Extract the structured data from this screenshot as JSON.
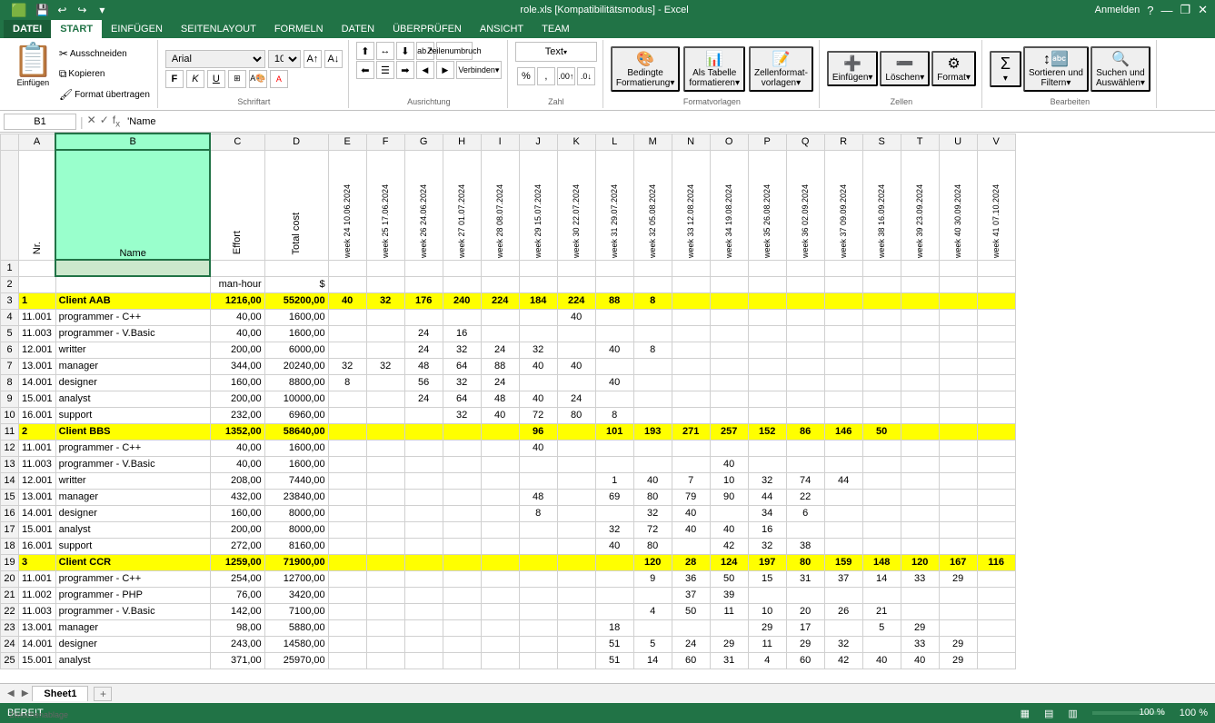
{
  "window": {
    "title": "role.xls [Kompatibilitätsmodus] - Excel",
    "help_icon": "?",
    "minimize": "—",
    "restore": "❐",
    "close": "✕"
  },
  "quick_access": {
    "save": "💾",
    "undo": "↩",
    "redo": "↪",
    "dropdown": "▾"
  },
  "ribbon": {
    "tabs": [
      {
        "id": "datei",
        "label": "DATEI"
      },
      {
        "id": "start",
        "label": "START",
        "active": true
      },
      {
        "id": "einfuegen",
        "label": "EINFÜGEN"
      },
      {
        "id": "seitenlayout",
        "label": "SEITENLAYOUT"
      },
      {
        "id": "formeln",
        "label": "FORMELN"
      },
      {
        "id": "daten",
        "label": "DATEN"
      },
      {
        "id": "ueberpruefen",
        "label": "ÜBERPRÜFEN"
      },
      {
        "id": "ansicht",
        "label": "ANSICHT"
      },
      {
        "id": "team",
        "label": "TEAM"
      }
    ],
    "groups": {
      "zwischenablage": "Zwischenablage",
      "schriftart": "Schriftart",
      "ausrichtung": "Ausrichtung",
      "zahl": "Zahl",
      "formatvorlagen": "Formatvorlagen",
      "zellen": "Zellen",
      "bearbeiten": "Bearbeiten"
    },
    "font_name": "Arial",
    "font_size": "10",
    "number_format": "Text",
    "anmelden": "Anmelden"
  },
  "formula_bar": {
    "cell_ref": "B1",
    "formula": "'Name"
  },
  "columns": {
    "row_num": "",
    "A": "A",
    "B": "B",
    "C": "C",
    "D": "D",
    "E": "E",
    "F": "F",
    "G": "G",
    "H": "H",
    "I": "I",
    "J": "J",
    "K": "K",
    "L": "L",
    "M": "M",
    "N": "N",
    "O": "O",
    "P": "P",
    "Q": "Q",
    "R": "R",
    "S": "S",
    "T": "T",
    "U": "U",
    "V": "V"
  },
  "week_headers": [
    "week 24 10.06.2024",
    "week 25 17.06.2024",
    "week 26 24.06.2024",
    "week 27 01.07.2024",
    "week 28 08.07.2024",
    "week 29 15.07.2024",
    "week 30 22.07.2024",
    "week 31 29.07.2024",
    "week 32 05.08.2024",
    "week 33 12.08.2024",
    "week 34 19.08.2024",
    "week 35 26.08.2024",
    "week 36 02.09.2024",
    "week 37 09.09.2024",
    "week 38 16.09.2024",
    "week 39 23.09.2024",
    "week 40 30.09.2024",
    "week 41 07.10.2024"
  ],
  "header_row": {
    "nr": "Nr.",
    "name": "Name",
    "effort": "Effort",
    "total_cost": "Total cost",
    "unit_row": {
      "effort": "man-hour",
      "total_cost": "$"
    }
  },
  "rows": [
    {
      "row": 1,
      "nr": "",
      "name": "",
      "effort": "",
      "total_cost": "",
      "yellow": false,
      "weeks": [
        "",
        "",
        "",
        "",
        "",
        "",
        "",
        "",
        "",
        "",
        "",
        "",
        "",
        "",
        "",
        "",
        "",
        ""
      ]
    },
    {
      "row": 2,
      "nr": "",
      "name": "",
      "effort": "man-hour",
      "total_cost": "$",
      "yellow": false,
      "weeks": [
        "",
        "",
        "",
        "",
        "",
        "",
        "",
        "",
        "",
        "",
        "",
        "",
        "",
        "",
        "",
        "",
        "",
        ""
      ]
    },
    {
      "row": 3,
      "nr": "1",
      "name": "Client AAB",
      "effort": "1216,00",
      "total_cost": "55200,00",
      "yellow": true,
      "weeks": [
        "40",
        "32",
        "176",
        "240",
        "224",
        "184",
        "224",
        "88",
        "8",
        "",
        "",
        "",
        "",
        "",
        "",
        "",
        "",
        ""
      ]
    },
    {
      "row": 4,
      "nr": "11.001",
      "name": "programmer - C++",
      "effort": "40,00",
      "total_cost": "1600,00",
      "yellow": false,
      "weeks": [
        "",
        "",
        "",
        "",
        "",
        "",
        "40",
        "",
        "",
        "",
        "",
        "",
        "",
        "",
        "",
        "",
        "",
        ""
      ]
    },
    {
      "row": 5,
      "nr": "11.003",
      "name": "programmer - V.Basic",
      "effort": "40,00",
      "total_cost": "1600,00",
      "yellow": false,
      "weeks": [
        "",
        "",
        "24",
        "16",
        "",
        "",
        "",
        "",
        "",
        "",
        "",
        "",
        "",
        "",
        "",
        "",
        "",
        ""
      ]
    },
    {
      "row": 6,
      "nr": "12.001",
      "name": "writter",
      "effort": "200,00",
      "total_cost": "6000,00",
      "yellow": false,
      "weeks": [
        "",
        "",
        "24",
        "32",
        "24",
        "32",
        "",
        "40",
        "8",
        "",
        "",
        "",
        "",
        "",
        "",
        "",
        "",
        ""
      ]
    },
    {
      "row": 7,
      "nr": "13.001",
      "name": "manager",
      "effort": "344,00",
      "total_cost": "20240,00",
      "yellow": false,
      "weeks": [
        "32",
        "32",
        "48",
        "64",
        "88",
        "40",
        "40",
        "",
        "",
        "",
        "",
        "",
        "",
        "",
        "",
        "",
        "",
        ""
      ]
    },
    {
      "row": 8,
      "nr": "14.001",
      "name": "designer",
      "effort": "160,00",
      "total_cost": "8800,00",
      "yellow": false,
      "weeks": [
        "8",
        "",
        "56",
        "32",
        "24",
        "",
        "",
        "40",
        "",
        "",
        "",
        "",
        "",
        "",
        "",
        "",
        "",
        ""
      ]
    },
    {
      "row": 9,
      "nr": "15.001",
      "name": "analyst",
      "effort": "200,00",
      "total_cost": "10000,00",
      "yellow": false,
      "weeks": [
        "",
        "",
        "24",
        "64",
        "48",
        "40",
        "24",
        "",
        "",
        "",
        "",
        "",
        "",
        "",
        "",
        "",
        "",
        ""
      ]
    },
    {
      "row": 10,
      "nr": "16.001",
      "name": "support",
      "effort": "232,00",
      "total_cost": "6960,00",
      "yellow": false,
      "weeks": [
        "",
        "",
        "",
        "32",
        "40",
        "72",
        "80",
        "8",
        "",
        "",
        "",
        "",
        "",
        "",
        "",
        "",
        "",
        ""
      ]
    },
    {
      "row": 11,
      "nr": "2",
      "name": "Client BBS",
      "effort": "1352,00",
      "total_cost": "58640,00",
      "yellow": true,
      "weeks": [
        "",
        "",
        "",
        "",
        "",
        "96",
        "",
        "101",
        "193",
        "271",
        "257",
        "152",
        "86",
        "146",
        "50",
        "",
        "",
        ""
      ]
    },
    {
      "row": 12,
      "nr": "11.001",
      "name": "programmer - C++",
      "effort": "40,00",
      "total_cost": "1600,00",
      "yellow": false,
      "weeks": [
        "",
        "",
        "",
        "",
        "",
        "40",
        "",
        "",
        "",
        "",
        "",
        "",
        "",
        "",
        "",
        "",
        "",
        ""
      ]
    },
    {
      "row": 13,
      "nr": "11.003",
      "name": "programmer - V.Basic",
      "effort": "40,00",
      "total_cost": "1600,00",
      "yellow": false,
      "weeks": [
        "",
        "",
        "",
        "",
        "",
        "",
        "",
        "",
        "",
        "",
        "40",
        "",
        "",
        "",
        "",
        "",
        "",
        ""
      ]
    },
    {
      "row": 14,
      "nr": "12.001",
      "name": "writter",
      "effort": "208,00",
      "total_cost": "7440,00",
      "yellow": false,
      "weeks": [
        "",
        "",
        "",
        "",
        "",
        "",
        "",
        "1",
        "40",
        "7",
        "10",
        "32",
        "74",
        "44",
        "",
        "",
        "",
        ""
      ]
    },
    {
      "row": 15,
      "nr": "13.001",
      "name": "manager",
      "effort": "432,00",
      "total_cost": "23840,00",
      "yellow": false,
      "weeks": [
        "",
        "",
        "",
        "",
        "",
        "48",
        "",
        "69",
        "80",
        "79",
        "90",
        "44",
        "22",
        "",
        "",
        "",
        "",
        ""
      ]
    },
    {
      "row": 16,
      "nr": "14.001",
      "name": "designer",
      "effort": "160,00",
      "total_cost": "8000,00",
      "yellow": false,
      "weeks": [
        "",
        "",
        "",
        "",
        "",
        "8",
        "",
        "",
        "32",
        "40",
        "",
        "34",
        "6",
        "",
        "",
        "",
        "",
        ""
      ]
    },
    {
      "row": 17,
      "nr": "15.001",
      "name": "analyst",
      "effort": "200,00",
      "total_cost": "8000,00",
      "yellow": false,
      "weeks": [
        "",
        "",
        "",
        "",
        "",
        "",
        "",
        "32",
        "72",
        "40",
        "40",
        "16",
        "",
        "",
        "",
        "",
        "",
        ""
      ]
    },
    {
      "row": 18,
      "nr": "16.001",
      "name": "support",
      "effort": "272,00",
      "total_cost": "8160,00",
      "yellow": false,
      "weeks": [
        "",
        "",
        "",
        "",
        "",
        "",
        "",
        "40",
        "80",
        "",
        "42",
        "32",
        "38",
        "",
        "",
        "",
        "",
        ""
      ]
    },
    {
      "row": 19,
      "nr": "3",
      "name": "Client CCR",
      "effort": "1259,00",
      "total_cost": "71900,00",
      "yellow": true,
      "weeks": [
        "",
        "",
        "",
        "",
        "",
        "",
        "",
        "",
        "120",
        "28",
        "124",
        "197",
        "80",
        "159",
        "148",
        "120",
        "167",
        "116"
      ]
    },
    {
      "row": 20,
      "nr": "11.001",
      "name": "programmer - C++",
      "effort": "254,00",
      "total_cost": "12700,00",
      "yellow": false,
      "weeks": [
        "",
        "",
        "",
        "",
        "",
        "",
        "",
        "",
        "9",
        "36",
        "50",
        "15",
        "31",
        "37",
        "14",
        "33",
        "29",
        ""
      ]
    },
    {
      "row": 21,
      "nr": "11.002",
      "name": "programmer - PHP",
      "effort": "76,00",
      "total_cost": "3420,00",
      "yellow": false,
      "weeks": [
        "",
        "",
        "",
        "",
        "",
        "",
        "",
        "",
        "",
        "37",
        "39",
        "",
        "",
        "",
        "",
        "",
        "",
        ""
      ]
    },
    {
      "row": 22,
      "nr": "11.003",
      "name": "programmer - V.Basic",
      "effort": "142,00",
      "total_cost": "7100,00",
      "yellow": false,
      "weeks": [
        "",
        "",
        "",
        "",
        "",
        "",
        "",
        "",
        "4",
        "50",
        "11",
        "10",
        "20",
        "26",
        "21",
        "",
        "",
        ""
      ]
    },
    {
      "row": 23,
      "nr": "13.001",
      "name": "manager",
      "effort": "98,00",
      "total_cost": "5880,00",
      "yellow": false,
      "weeks": [
        "",
        "",
        "",
        "",
        "",
        "",
        "",
        "18",
        "",
        "",
        "",
        "29",
        "17",
        "",
        "5",
        "29",
        "",
        ""
      ]
    },
    {
      "row": 24,
      "nr": "14.001",
      "name": "designer",
      "effort": "243,00",
      "total_cost": "14580,00",
      "yellow": false,
      "weeks": [
        "",
        "",
        "",
        "",
        "",
        "",
        "",
        "51",
        "5",
        "24",
        "29",
        "11",
        "29",
        "32",
        "",
        "33",
        "29",
        ""
      ]
    },
    {
      "row": 25,
      "nr": "15.001",
      "name": "analyst",
      "effort": "371,00",
      "total_cost": "25970,00",
      "yellow": false,
      "weeks": [
        "",
        "",
        "",
        "",
        "",
        "",
        "",
        "51",
        "14",
        "60",
        "31",
        "4",
        "60",
        "42",
        "40",
        "40",
        "29",
        ""
      ]
    }
  ],
  "sheet_tabs": [
    {
      "label": "Sheet1",
      "active": true
    }
  ],
  "status_bar": {
    "ready": "BEREIT",
    "zoom": "100 %"
  }
}
